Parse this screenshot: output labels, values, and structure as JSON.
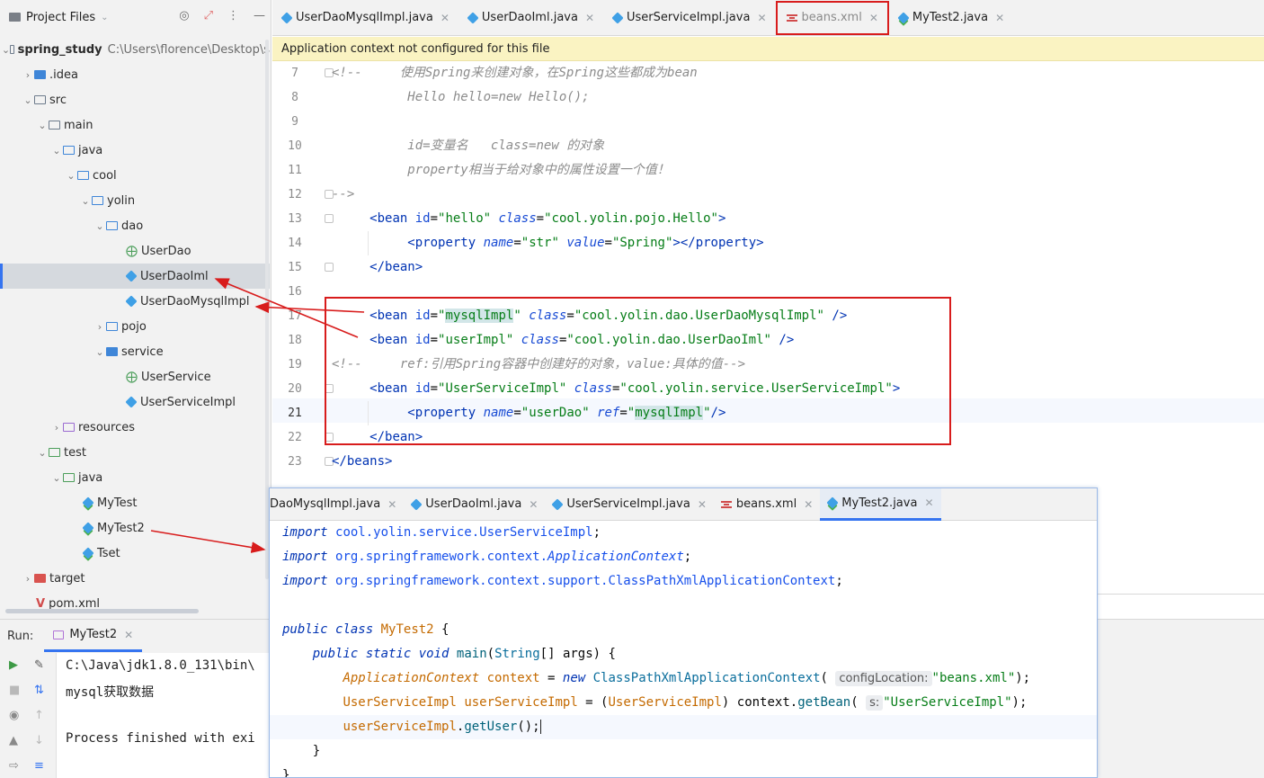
{
  "project_panel": {
    "title": "Project Files",
    "tree": [
      {
        "label": "spring_study",
        "path": "C:\\Users\\florence\\Desktop\\s",
        "bold": true
      },
      {
        "label": ".idea"
      },
      {
        "label": "src"
      },
      {
        "label": "main"
      },
      {
        "label": "java"
      },
      {
        "label": "cool"
      },
      {
        "label": "yolin"
      },
      {
        "label": "dao"
      },
      {
        "label": "UserDao"
      },
      {
        "label": "UserDaoIml"
      },
      {
        "label": "UserDaoMysqlImpl"
      },
      {
        "label": "pojo"
      },
      {
        "label": "service"
      },
      {
        "label": "UserService"
      },
      {
        "label": "UserServiceImpl"
      },
      {
        "label": "resources"
      },
      {
        "label": "test"
      },
      {
        "label": "java"
      },
      {
        "label": "MyTest"
      },
      {
        "label": "MyTest2"
      },
      {
        "label": "Tset"
      },
      {
        "label": "target"
      },
      {
        "label": "pom.xml"
      }
    ]
  },
  "editor_tabs": [
    {
      "label": "UserDaoMysqlImpl.java"
    },
    {
      "label": "UserDaoIml.java"
    },
    {
      "label": "UserServiceImpl.java"
    },
    {
      "label": "beans.xml"
    },
    {
      "label": "MyTest2.java"
    }
  ],
  "banner": "Application context not configured for this file",
  "main_editor": {
    "line_numbers": [
      "7",
      "8",
      "9",
      "10",
      "11",
      "12",
      "13",
      "14",
      "15",
      "16",
      "17",
      "18",
      "19",
      "20",
      "21",
      "22",
      "23"
    ],
    "current_line": "21",
    "comment": {
      "l7_open": "<!--",
      "l7_text": "使用Spring来创建对象，在Spring这些都成为bean",
      "l8_text": "Hello hello=new Hello();",
      "l10_a": "id=变量名",
      "l10_b": "class=new",
      "l10_c": "的对象",
      "l11_text": "property相当于给对象中的属性设置一个值！",
      "l12_close": "-->"
    },
    "xml": {
      "bean_tag": "bean",
      "property_tag": "property",
      "beans_tag": "beans",
      "id_attr": "id",
      "class_attr": "class",
      "name_attr": "name",
      "value_attr": "value",
      "ref_attr": "ref",
      "hello_id": "\"hello\"",
      "hello_class": "\"cool.yolin.pojo.Hello\"",
      "str_name": "\"str\"",
      "spring_value": "\"Spring\"",
      "mysql_id": "mysqlImpl",
      "mysql_class": "\"cool.yolin.dao.UserDaoMysqlImpl\"",
      "user_id": "\"userImpl\"",
      "user_class": "\"cool.yolin.dao.UserDaoIml\"",
      "comment19": "<!--     ref:引用Spring容器中创建好的对象，value:具体的值-->",
      "service_id": "UserServiceImpl",
      "service_class": "\"cool.yolin.service.UserServiceImpl\"",
      "userdao_name": "\"userDao\"",
      "ref_value": "mysqlImpl"
    }
  },
  "overlay": {
    "tabs": [
      {
        "label": "DaoMysqlImpl.java"
      },
      {
        "label": "UserDaoIml.java"
      },
      {
        "label": "UserServiceImpl.java"
      },
      {
        "label": "beans.xml"
      },
      {
        "label": "MyTest2.java"
      }
    ],
    "code": {
      "import_kw": "import",
      "imp1": "cool.yolin.service.UserServiceImpl",
      "imp2_pkg": "org.springframework.context.",
      "imp2_cls": "ApplicationContext",
      "imp3_pkg": "org.springframework.context.support.",
      "imp3_cls": "ClassPathXmlApplicationContext",
      "public_kw": "public",
      "class_kw": "class",
      "class_name": "MyTest2",
      "static_kw": "static",
      "void_kw": "void",
      "main_fn": "main",
      "string_type": "String",
      "args": "args",
      "ctx_type": "ApplicationContext",
      "ctx_var": "context",
      "new_kw": "new",
      "cpx": "ClassPathXmlApplicationContext",
      "hint1": "configLocation:",
      "beans_str": "\"beans.xml\"",
      "usi_type": "UserServiceImpl",
      "usi_var": "userServiceImpl",
      "get_bean": "getBean",
      "hint2": "s:",
      "usi_str": "\"UserServiceImpl\"",
      "get_user": "getUser"
    }
  },
  "run_panel": {
    "label": "Run:",
    "tab": "MyTest2",
    "console": [
      "C:\\Java\\jdk1.8.0_131\\bin\\",
      "mysql获取数据",
      "",
      "Process finished with exi"
    ]
  },
  "colors": {
    "highlight_box": "#d81c1c",
    "arrow": "#d81c1c",
    "accent": "#3574f0",
    "banner": "#faf3c2"
  }
}
